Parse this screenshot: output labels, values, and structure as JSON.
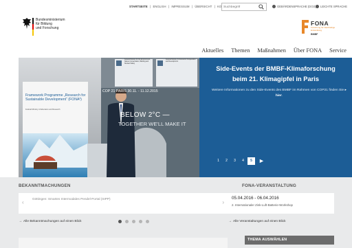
{
  "top_links": {
    "home": "STARTSEITE",
    "english": "ENGLISH",
    "imprint": "IMPRESSUM",
    "overview": "ÜBERSICHT",
    "contact": "KONTAKT",
    "sep": "|"
  },
  "search": {
    "placeholder": "Suchbegriff",
    "icon": "magnifier-icon"
  },
  "accessibility": {
    "sign_language": "GEBÄRDENSPRACHE (DGS)",
    "easy_language": "LEICHTE SPRACHE"
  },
  "ministry": {
    "line1": "Bundesministerium",
    "line2": "für Bildung",
    "line3": "und Forschung"
  },
  "fona": {
    "name": "FONA",
    "subtitle": "Forschung für Nachhaltige Entwicklung",
    "sponsor": "BMBF"
  },
  "nav": [
    "Aktuelles",
    "Themen",
    "Maßnahmen",
    "Über FONA",
    "Service"
  ],
  "hero": {
    "title_line1": "Side-Events der BMBF-Klimaforschung",
    "title_line2": "beim 21. Klimagipfel in Paris",
    "text": "Weitere Informationen zu den Side-Events des BMBF im Rahmen von COP21 finden Sie",
    "link": "hier",
    "link_suffix": ".",
    "image_texts": {
      "banner_left": "Framework Programme „Research for Sustainable Development“ (FONA³)",
      "banner_left_small": "Federal Ministry of Education and Research",
      "cop": "COP 21 PARIS  30.11. - 11.12.2015",
      "below": "BELOW 2°C —",
      "together": "TOGETHER WE'LL MAKE IT",
      "sign_1": "Federal Ministry for the Environment, Nature Conservation, Building and Nuclear Safety",
      "sign_2": "Federal Ministry for Economic Cooperation and Development"
    },
    "pages": [
      "1",
      "2",
      "3",
      "4",
      "5"
    ],
    "active_page": "5"
  },
  "announcements": {
    "heading": "BEKANNTMACHUNGEN",
    "item": "Göttingen: Smartes Intermodales Pendel-Portal (SIPP)",
    "all_link": "Alle Bekanntmachungen auf einen Blick",
    "dots_total": 5,
    "dots_active": 1
  },
  "events": {
    "heading": "FONA-VERANSTALTUNG",
    "date": "05.04.2016 - 06.04.2016",
    "title": "2. Internationaler Zink-Luft-Batterie-Workshop",
    "all_link": "Alle Veranstaltungen auf einen Blick"
  },
  "theme_select": {
    "label": "THEMA AUSWÄHLEN"
  },
  "colors": {
    "hero_blue": "#1c5d96",
    "fona_orange": "#e8882a",
    "panel_grey": "#e9eaeb",
    "theme_header": "#6c6c6c"
  }
}
